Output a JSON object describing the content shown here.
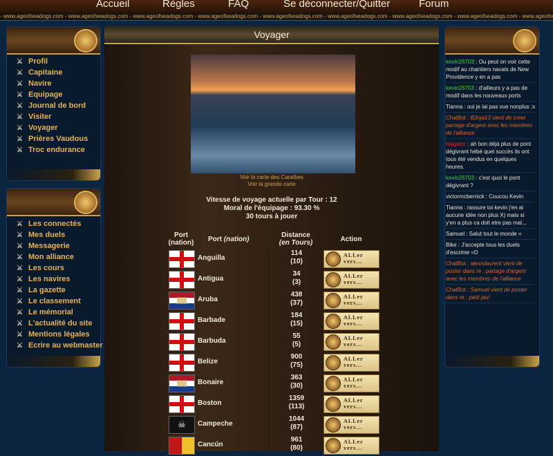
{
  "nav": {
    "accueil": "Accueil",
    "regles": "Règles",
    "faq": "FAQ",
    "deconnecter": "Se déconnecter/Quitter",
    "forum": "Forum"
  },
  "strip_text": "- www.ageofseadogs.com - www.ageofseadogs.com - www.ageofseadogs.com - www.ageofseadogs.com - www.ageofseadogs.com - www.ageofseadogs.com - www.ageofseadogs.com - www.ageofseadogs.com - www.ageofseadogs.com -",
  "menu1": [
    "Profil",
    "Capitaine",
    "Navire",
    "Equipage",
    "Journal de bord",
    "Visiter",
    "Voyager",
    "Prières Vaudous",
    "Troc endurance"
  ],
  "menu2": [
    "Les connectés",
    "Mes duels",
    "Messagerie",
    "Mon alliance",
    "Les cours",
    "Les navires",
    "La gazette",
    "Le classement",
    "Le mémorial",
    "L'actualité du site",
    "Mentions légales",
    "Ecrire au webmaster"
  ],
  "center": {
    "title": "Voyager",
    "map_caribbean": "Voir la carte des Caraïbes",
    "map_big": "Voir la grande carte",
    "speed": "Vitesse de voyage actuelle par Tour : 12",
    "moral": "Moral de l'équipage : 93.30 %",
    "turns": "30 tours à jouer",
    "headers": {
      "port": "Port",
      "nation": "(nation)",
      "port2": "Port",
      "nation2": "(nation)",
      "distance": "Distance",
      "en_tours": "(en Tours)",
      "action": "Action"
    },
    "button_line1": "ALLer",
    "button_line2": "vers...",
    "ports": [
      {
        "name": "Anguilla",
        "dist": "114",
        "tours": "(10)",
        "flag": "eng"
      },
      {
        "name": "Antigua",
        "dist": "34",
        "tours": "(3)",
        "flag": "eng"
      },
      {
        "name": "Aruba",
        "dist": "438",
        "tours": "(37)",
        "flag": "nl"
      },
      {
        "name": "Barbade",
        "dist": "184",
        "tours": "(15)",
        "flag": "eng"
      },
      {
        "name": "Barbuda",
        "dist": "55",
        "tours": "(5)",
        "flag": "eng"
      },
      {
        "name": "Belize",
        "dist": "900",
        "tours": "(75)",
        "flag": "eng"
      },
      {
        "name": "Bonaire",
        "dist": "363",
        "tours": "(30)",
        "flag": "nl"
      },
      {
        "name": "Boston",
        "dist": "1359",
        "tours": "(113)",
        "flag": "eng"
      },
      {
        "name": "Campeche",
        "dist": "1044",
        "tours": "(87)",
        "flag": "pirate"
      },
      {
        "name": "Cancún",
        "dist": "961",
        "tours": "(80)",
        "flag": "es"
      }
    ]
  },
  "chat": [
    {
      "user": "kevin26703",
      "ucls": "u-green",
      "text": " : Ou peut on voir cette modif au chantiers navals de New Providence y en a pas"
    },
    {
      "user": "kevin26703",
      "ucls": "u-green",
      "text": " : d'ailleurs y a pas de modif dans les nouveaux ports"
    },
    {
      "user": "Tianna",
      "ucls": "",
      "text": " : oui je lai pas vue nonplus :x"
    },
    {
      "user": "ChatBot",
      "ucls": "u-bot",
      "text": " : B3nja13 vient de creer partage d'argent avec les membres de l'alliance",
      "italic": true
    },
    {
      "user": "blagator",
      "ucls": "u-red",
      "text": " : ah bon déjà plus de pont dégivrant hébé quel succès ils ont tous été vendus en quelques heures."
    },
    {
      "user": "kevin26703",
      "ucls": "u-green",
      "text": " : c'est quoi le pont dégivrant ?"
    },
    {
      "user": "victormcbernick",
      "ucls": "",
      "text": " : Coucou Kevin"
    },
    {
      "user": "Tianna",
      "ucls": "",
      "text": " : rassure toi kevin j'en ai aucune idée non plus X) mais si y'en a plus ca doit etre pas mal..."
    },
    {
      "user": "Samuel",
      "ucls": "",
      "text": " : Salut tout le monde ="
    },
    {
      "user": "Bike",
      "ucls": "",
      "text": " : J'accepte tous les duels d'escrime =D"
    },
    {
      "user": "ChatBot",
      "ucls": "u-bot",
      "text": " : alexislaurent vient de poster dans re : partage d'argent avec les membres de l'alliance",
      "italic": true
    },
    {
      "user": "ChatBot",
      "ucls": "u-bot",
      "text": " : Samuel vient de poster dans re : petit jeu!",
      "italic": true
    }
  ]
}
